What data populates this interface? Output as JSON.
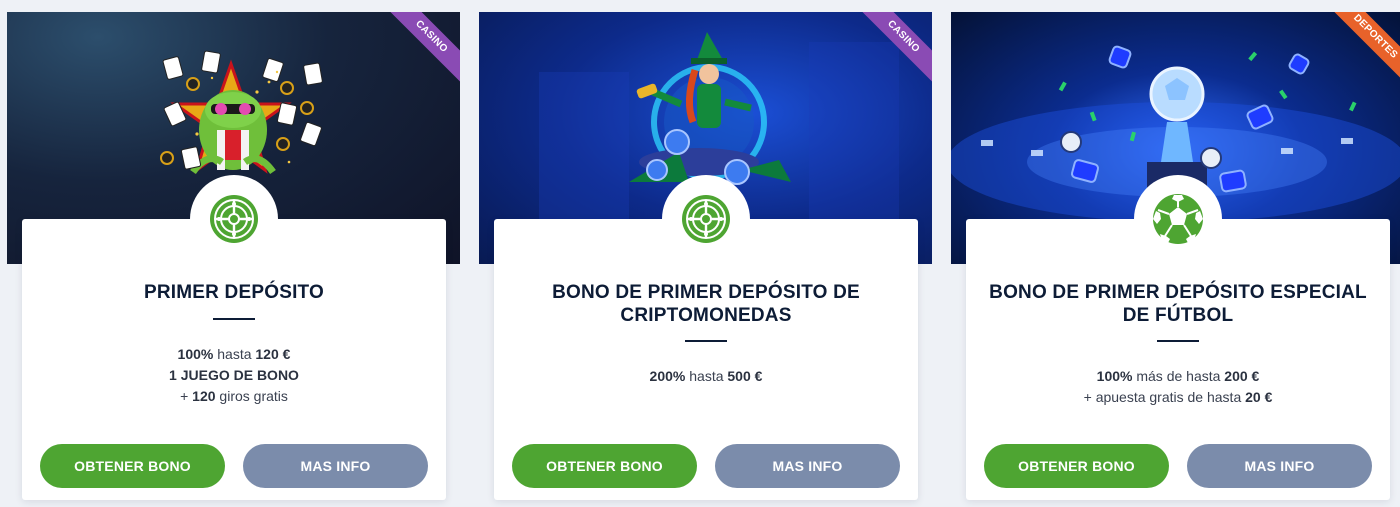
{
  "colors": {
    "primary_button": "#4ea532",
    "secondary_button": "#7b8cab",
    "casino_ribbon": "#8a4bb4",
    "sport_ribbon": "#e8622a",
    "title_text": "#0d1c36"
  },
  "cards": [
    {
      "ribbon": "CASINO",
      "icon": "roulette-icon",
      "banner_art": "frog-with-cards-illustration",
      "title": "PRIMER DEPÓSITO",
      "lines": [
        [
          {
            "b": "100%"
          },
          {
            "t": " hasta "
          },
          {
            "b": "120 €"
          }
        ],
        [
          {
            "b": "1 JUEGO DE BONO"
          }
        ],
        [
          {
            "t": "+ "
          },
          {
            "b": "120"
          },
          {
            "t": " giros gratis"
          }
        ]
      ],
      "primary_button": "OBTENER BONO",
      "secondary_button": "MAS INFO"
    },
    {
      "ribbon": "CASINO",
      "icon": "roulette-icon",
      "banner_art": "leprechaun-crypto-illustration",
      "title": "BONO DE PRIMER DEPÓSITO DE CRIPTOMONEDAS",
      "lines": [
        [
          {
            "b": "200%"
          },
          {
            "t": " hasta "
          },
          {
            "b": "500 €"
          }
        ]
      ],
      "primary_button": "OBTENER BONO",
      "secondary_button": "MAS INFO"
    },
    {
      "ribbon": "DEPORTES",
      "icon": "soccer-ball-icon",
      "banner_art": "stadium-trophy-illustration",
      "title": "BONO DE PRIMER DEPÓSITO ESPECIAL DE FÚTBOL",
      "lines": [
        [
          {
            "b": "100%"
          },
          {
            "t": " más de hasta "
          },
          {
            "b": "200 €"
          }
        ],
        [
          {
            "t": "+ apuesta gratis de hasta "
          },
          {
            "b": "20 €"
          }
        ]
      ],
      "primary_button": "OBTENER BONO",
      "secondary_button": "MAS INFO"
    }
  ]
}
